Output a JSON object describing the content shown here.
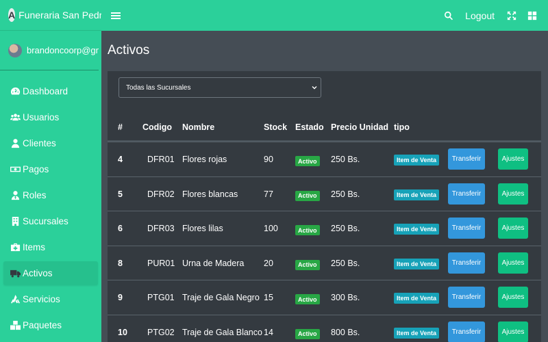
{
  "brand": {
    "name": "Funeraria San Pedro",
    "logo_letter": "A"
  },
  "user": {
    "name": "brandoncoorp@gmail"
  },
  "sidebar": {
    "items": [
      {
        "label": "Dashboard",
        "icon": "dashboard-icon",
        "active": false
      },
      {
        "label": "Usuarios",
        "icon": "users-icon",
        "active": false
      },
      {
        "label": "Clientes",
        "icon": "user-icon",
        "active": false
      },
      {
        "label": "Pagos",
        "icon": "money-icon",
        "active": false
      },
      {
        "label": "Roles",
        "icon": "user-tie-icon",
        "active": false
      },
      {
        "label": "Sucursales",
        "icon": "building-icon",
        "active": false
      },
      {
        "label": "Items",
        "icon": "medkit-icon",
        "active": false
      },
      {
        "label": "Activos",
        "icon": "truck-icon",
        "active": true
      },
      {
        "label": "Servicios",
        "icon": "hands-icon",
        "active": false
      },
      {
        "label": "Paquetes",
        "icon": "boxes-icon",
        "active": false
      }
    ]
  },
  "topbar": {
    "logout_label": "Logout"
  },
  "page": {
    "title": "Activos"
  },
  "filter": {
    "selected": "Todas las Sucursales"
  },
  "table": {
    "headers": [
      "#",
      "Codigo",
      "Nombre",
      "Stock",
      "Estado",
      "Precio Unidad",
      "tipo"
    ],
    "rows": [
      {
        "id": "4",
        "codigo": "DFR01",
        "nombre": "Flores rojas",
        "stock": "90",
        "estado": "Activo",
        "precio": "250 Bs.",
        "tipo": "Item de Venta"
      },
      {
        "id": "5",
        "codigo": "DFR02",
        "nombre": "Flores blancas",
        "stock": "77",
        "estado": "Activo",
        "precio": "250 Bs.",
        "tipo": "Item de Venta"
      },
      {
        "id": "6",
        "codigo": "DFR03",
        "nombre": "Flores lilas",
        "stock": "100",
        "estado": "Activo",
        "precio": "250 Bs.",
        "tipo": "Item de Venta"
      },
      {
        "id": "8",
        "codigo": "PUR01",
        "nombre": "Urna de Madera",
        "stock": "20",
        "estado": "Activo",
        "precio": "250 Bs.",
        "tipo": "Item de Venta"
      },
      {
        "id": "9",
        "codigo": "PTG01",
        "nombre": "Traje de Gala Negro",
        "stock": "15",
        "estado": "Activo",
        "precio": "300 Bs.",
        "tipo": "Item de Venta"
      },
      {
        "id": "10",
        "codigo": "PTG02",
        "nombre": "Traje de Gala Blanco",
        "stock": "14",
        "estado": "Activo",
        "precio": "800 Bs.",
        "tipo": "Item de Venta"
      }
    ],
    "transfer_label": "Transferir",
    "ajustes_label": "Ajustes"
  },
  "colors": {
    "brand_green": "#2bd09a",
    "content_bg": "#454d55",
    "card_bg": "#343a40",
    "badge_estado": "#28a745",
    "badge_tipo": "#17a2b8",
    "transfer_btn": "#3397dc",
    "ajustes_btn": "#0fbf82"
  }
}
